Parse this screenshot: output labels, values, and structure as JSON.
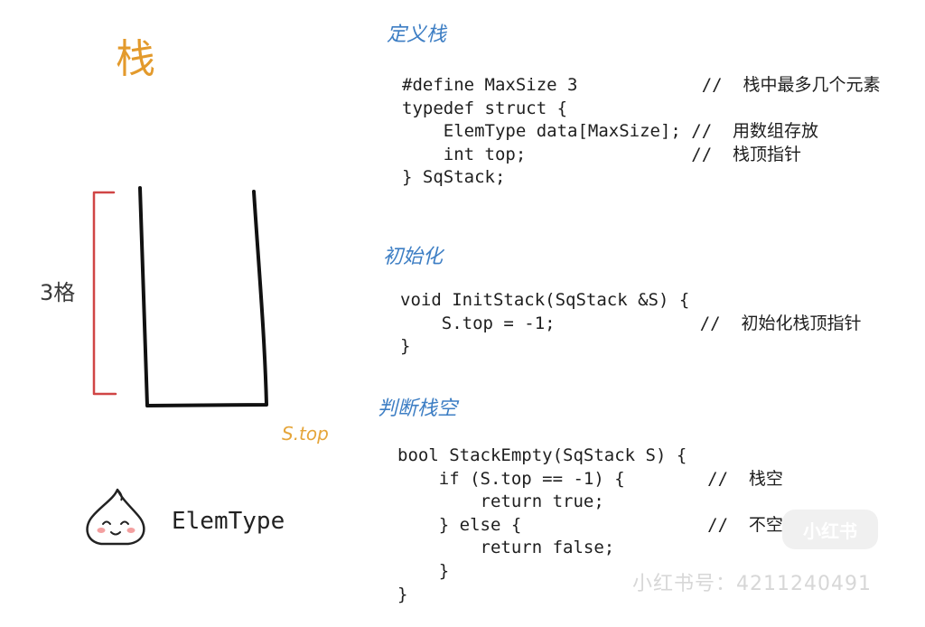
{
  "title": "栈",
  "diagram": {
    "capacity_label": "3格",
    "pointer_label": "S.top",
    "element_label": "ElemType",
    "colors": {
      "bracket": "#d04545",
      "container": "#111111",
      "title": "#e39a2c",
      "pointer": "#e5a53a",
      "heading": "#3d7ec4"
    },
    "icons": [
      "bracket-icon",
      "stack-container-icon",
      "dumpling-face-icon"
    ]
  },
  "sections": [
    {
      "heading": "定义栈",
      "code": [
        "#define MaxSize 3            //  栈中最多几个元素",
        "typedef struct {",
        "    ElemType data[MaxSize]; //  用数组存放",
        "    int top;                //  栈顶指针",
        "} SqStack;"
      ]
    },
    {
      "heading": "初始化",
      "code": [
        "void InitStack(SqStack &S) {",
        "    S.top = -1;              //  初始化栈顶指针",
        "}"
      ]
    },
    {
      "heading": "判断栈空",
      "code": [
        "bool StackEmpty(SqStack S) {",
        "    if (S.top == -1) {        //  栈空",
        "        return true;",
        "    } else {                  //  不空",
        "        return false;",
        "    }",
        "}"
      ]
    }
  ],
  "watermark": {
    "badge": "小红书",
    "account": "小红书号：4211240491"
  }
}
